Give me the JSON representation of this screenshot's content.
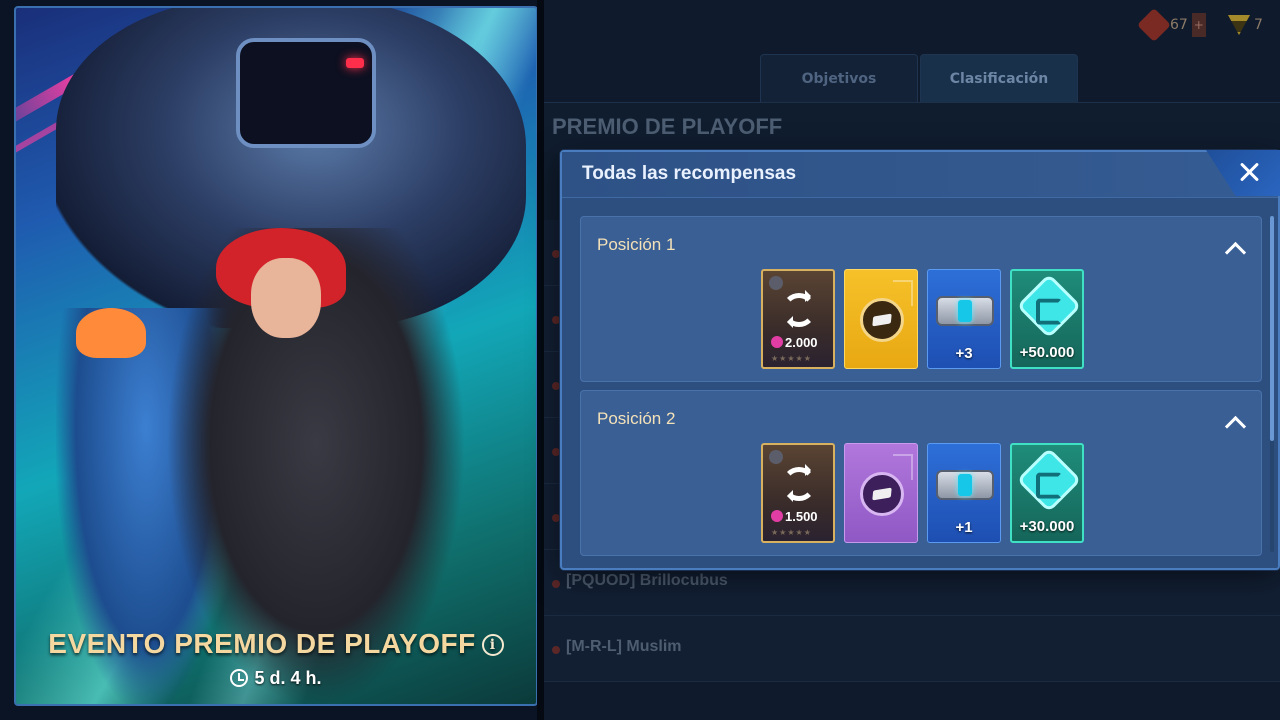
{
  "event": {
    "title": "EVENTO PREMIO DE PLAYOFF",
    "info_glyph": "i",
    "timer": "5 d. 4 h."
  },
  "top_bar": {
    "currency_a_value": "67",
    "currency_b_value": "7",
    "plus_glyph": "+"
  },
  "tabs": [
    {
      "label": "Objetivos",
      "active": false
    },
    {
      "label": "Clasificación",
      "active": true
    }
  ],
  "background_panel": {
    "title": "PREMIO DE PLAYOFF",
    "rows": [
      {
        "name": ""
      },
      {
        "name": ""
      },
      {
        "name": ""
      },
      {
        "name": ""
      },
      {
        "name": ""
      },
      {
        "name": "[PQUOD] Brillocubus"
      },
      {
        "name": "[M-R-L] Muslim"
      }
    ]
  },
  "modal": {
    "title": "Todas las recompensas",
    "positions": [
      {
        "label": "Posición 1",
        "rewards": [
          {
            "type": "pilot",
            "icon": "refresh-icon",
            "amount": "2.000"
          },
          {
            "type": "module",
            "rarity": "gold",
            "icon": "module-icon",
            "amount": ""
          },
          {
            "type": "booster",
            "icon": "booster-icon",
            "amount": "+3"
          },
          {
            "type": "credits",
            "icon": "credit-icon",
            "amount": "+50.000"
          }
        ]
      },
      {
        "label": "Posición 2",
        "rewards": [
          {
            "type": "pilot",
            "icon": "refresh-icon",
            "amount": "1.500"
          },
          {
            "type": "module",
            "rarity": "purple",
            "icon": "module-icon",
            "amount": ""
          },
          {
            "type": "booster",
            "icon": "booster-icon",
            "amount": "+1"
          },
          {
            "type": "credits",
            "icon": "credit-icon",
            "amount": "+30.000"
          }
        ]
      }
    ]
  },
  "colors": {
    "modal_bg": "#2d4f80",
    "title_gold": "#f5d7a0",
    "credits_teal": "#40e0c5",
    "pilot_border": "#d8b160"
  }
}
